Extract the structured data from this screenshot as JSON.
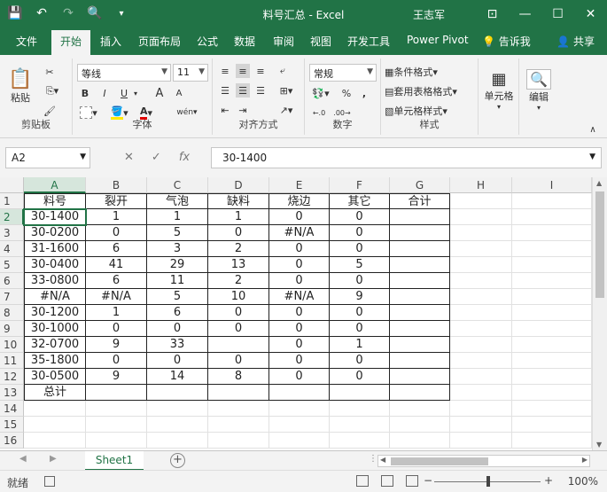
{
  "app": {
    "title": "料号汇总 - Excel",
    "user": "王志军",
    "share": "共享",
    "tellme": "告诉我"
  },
  "tabs": [
    "文件",
    "开始",
    "插入",
    "页面布局",
    "公式",
    "数据",
    "审阅",
    "视图",
    "开发工具",
    "Power Pivot"
  ],
  "ribbon": {
    "clipboard": {
      "label": "剪贴板",
      "paste": "粘贴"
    },
    "font": {
      "label": "字体",
      "name": "等线",
      "size": "11",
      "bold": "B",
      "italic": "I",
      "underline": "U",
      "grow": "A",
      "shrink": "A",
      "wen": "wén"
    },
    "align": {
      "label": "对齐方式"
    },
    "number": {
      "label": "数字",
      "format": "常规"
    },
    "styles": {
      "label": "样式",
      "cond": "条件格式",
      "table": "套用表格格式",
      "cell": "单元格样式"
    },
    "cells": {
      "label": "单元格"
    },
    "edit": {
      "label": "编辑"
    }
  },
  "formula_bar": {
    "namebox": "A2",
    "fx": "fx",
    "value": "30-1400"
  },
  "columns": [
    "A",
    "B",
    "C",
    "D",
    "E",
    "F",
    "G",
    "H",
    "I"
  ],
  "rows": [
    "1",
    "2",
    "3",
    "4",
    "5",
    "6",
    "7",
    "8",
    "9",
    "10",
    "11",
    "12",
    "13",
    "14",
    "15",
    "16"
  ],
  "table": {
    "headers": [
      "料号",
      "裂开",
      "气泡",
      "缺料",
      "烧边",
      "其它",
      "合计"
    ],
    "data": [
      [
        "30-1400",
        "1",
        "1",
        "1",
        "0",
        "0",
        ""
      ],
      [
        "30-0200",
        "0",
        "5",
        "0",
        "#N/A",
        "0",
        ""
      ],
      [
        "31-1600",
        "6",
        "3",
        "2",
        "0",
        "0",
        ""
      ],
      [
        "30-0400",
        "41",
        "29",
        "13",
        "0",
        "5",
        ""
      ],
      [
        "33-0800",
        "6",
        "11",
        "2",
        "0",
        "0",
        ""
      ],
      [
        "#N/A",
        "#N/A",
        "5",
        "10",
        "#N/A",
        "9",
        ""
      ],
      [
        "30-1200",
        "1",
        "6",
        "0",
        "0",
        "0",
        ""
      ],
      [
        "30-1000",
        "0",
        "0",
        "0",
        "0",
        "0",
        ""
      ],
      [
        "32-0700",
        "9",
        "33",
        "",
        "0",
        "1",
        ""
      ],
      [
        "35-1800",
        "0",
        "0",
        "0",
        "0",
        "0",
        ""
      ],
      [
        "30-0500",
        "9",
        "14",
        "8",
        "0",
        "0",
        ""
      ],
      [
        "总计",
        "",
        "",
        "",
        "",
        "",
        ""
      ]
    ]
  },
  "sheets": [
    "Sheet1"
  ],
  "status": {
    "ready": "就绪",
    "zoom": "100%"
  }
}
